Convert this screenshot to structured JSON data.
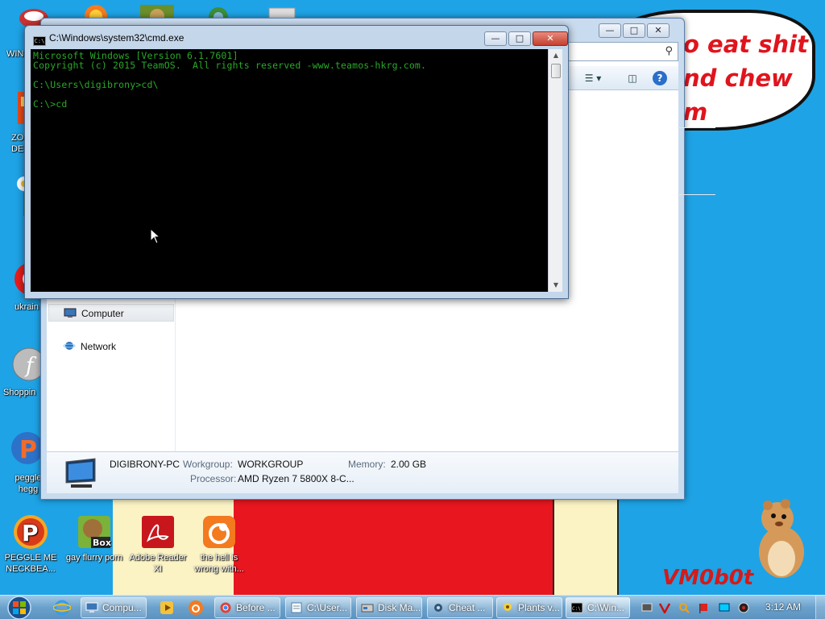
{
  "desktop": {
    "speech_bubble": "o eat shit\nnd chew\nm",
    "watermark": "VM0b0t",
    "icons_left": [
      {
        "label": "WIN V"
      },
      {
        "label": "ZO DE"
      },
      {
        "label": "ukrain"
      },
      {
        "label": "Shoppin"
      },
      {
        "label": "peggle hegg"
      }
    ],
    "icons_bottom": [
      {
        "label": "PEGGLE ME NECKBEA..."
      },
      {
        "label": "gay flurry porn",
        "badge": "Box"
      },
      {
        "label": "Adobe Reader XI"
      },
      {
        "label": "the hell is wrong with..."
      }
    ]
  },
  "explorer": {
    "nav": [
      {
        "label": "Computer",
        "selected": true
      },
      {
        "label": "Network",
        "selected": false
      }
    ],
    "details": {
      "computer_name": "DIGIBRONY-PC",
      "workgroup_label": "Workgroup:",
      "workgroup_value": "WORKGROUP",
      "memory_label": "Memory:",
      "memory_value": "2.00 GB",
      "processor_label": "Processor:",
      "processor_value": "AMD Ryzen 7 5800X 8-C..."
    }
  },
  "cmd": {
    "title": "C:\\Windows\\system32\\cmd.exe",
    "lines": [
      "Microsoft Windows [Version 6.1.7601]",
      "Copyright (c) 2015 TeamOS.  All rights reserved -www.teamos-hkrg.com.",
      "",
      "C:\\Users\\digibrony>cd\\",
      "",
      "C:\\>cd"
    ]
  },
  "taskbar": {
    "tasks": [
      {
        "label": "Compu...",
        "icon": "computer-icon",
        "active": false
      },
      {
        "label": "Before ...",
        "icon": "chrome-icon",
        "active": false
      },
      {
        "label": "C:\\User...",
        "icon": "notepad-icon",
        "active": false
      },
      {
        "label": "Disk Ma...",
        "icon": "disk-management-icon",
        "active": false
      },
      {
        "label": "Cheat ...",
        "icon": "gear-icon",
        "active": false
      },
      {
        "label": "Plants v...",
        "icon": "plant-icon",
        "active": false
      },
      {
        "label": "C:\\Win...",
        "icon": "cmd-icon",
        "active": true
      }
    ],
    "clock": "3:12 AM"
  },
  "colors": {
    "desktop_bg": "#1ea3e6",
    "console_text": "#2aa82a",
    "bubble_text": "#e0141d"
  }
}
